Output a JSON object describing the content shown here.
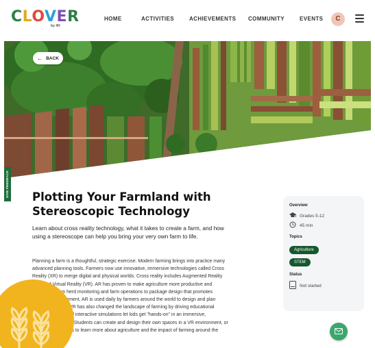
{
  "brand": {
    "logo_letters": [
      "C",
      "L",
      "O",
      "V",
      "E",
      "R"
    ],
    "logo_sub": "by 4H",
    "colors": {
      "green": "#2f7d47",
      "yellow": "#e3a81c",
      "red": "#e04a3c",
      "blue": "#2a9fd6",
      "purple": "#7d4fb3"
    }
  },
  "nav": {
    "items": [
      "HOME",
      "ACTIVITIES",
      "ACHIEVEMENTS",
      "COMMUNITY",
      "EVENTS"
    ],
    "avatar_initial": "C"
  },
  "hero": {
    "back_label": "BACK",
    "image": "aerial farm fields"
  },
  "feedback_tab": "SIVE FEEDBACK",
  "article": {
    "title": "Plotting Your Farmland with Stereoscopic Technology",
    "subtitle": "Learn about cross reality technology, what it takes to create a farm, and how using a stereoscope can help you bring your very own farm to life.",
    "body": "Planning a farm is a thoughtful, strategic exercise. Modern farming brings into practice many advanced planning tools. Farmers now use innovative, immersive technologies called Cross Reality (XR) to merge digital and physical worlds. Cross reality includes Augmented Reality (AR) and Virtual Reality (VR). AR has proven to make agriculture more productive and profitable. From herd monitoring and farm operations to package design that promotes customer engagement, AR is used daily by farmers around the world to design and plan farming systems. VR has also changed the landscape of farming by driving educational platforms. Apps and interactive simulations let kids get \"hands-on\" in an immersive, collaborative world. Students can create and design their own spaces in a VR environment, or explore new spaces to learn more about agriculture and the impact of farming around the world."
  },
  "sidebar": {
    "overview_label": "Overview",
    "grades": "Grades 5-12",
    "duration": "45 min",
    "topics_label": "Topics",
    "topics": [
      "Agriculture",
      "STEM"
    ],
    "status_label": "Status",
    "status_value": "Not started"
  },
  "icons": [
    "graduation-cap-icon",
    "clock-icon",
    "clipboard-icon",
    "mail-icon",
    "menu-icon",
    "arrow-left-icon",
    "wheat-icon"
  ]
}
